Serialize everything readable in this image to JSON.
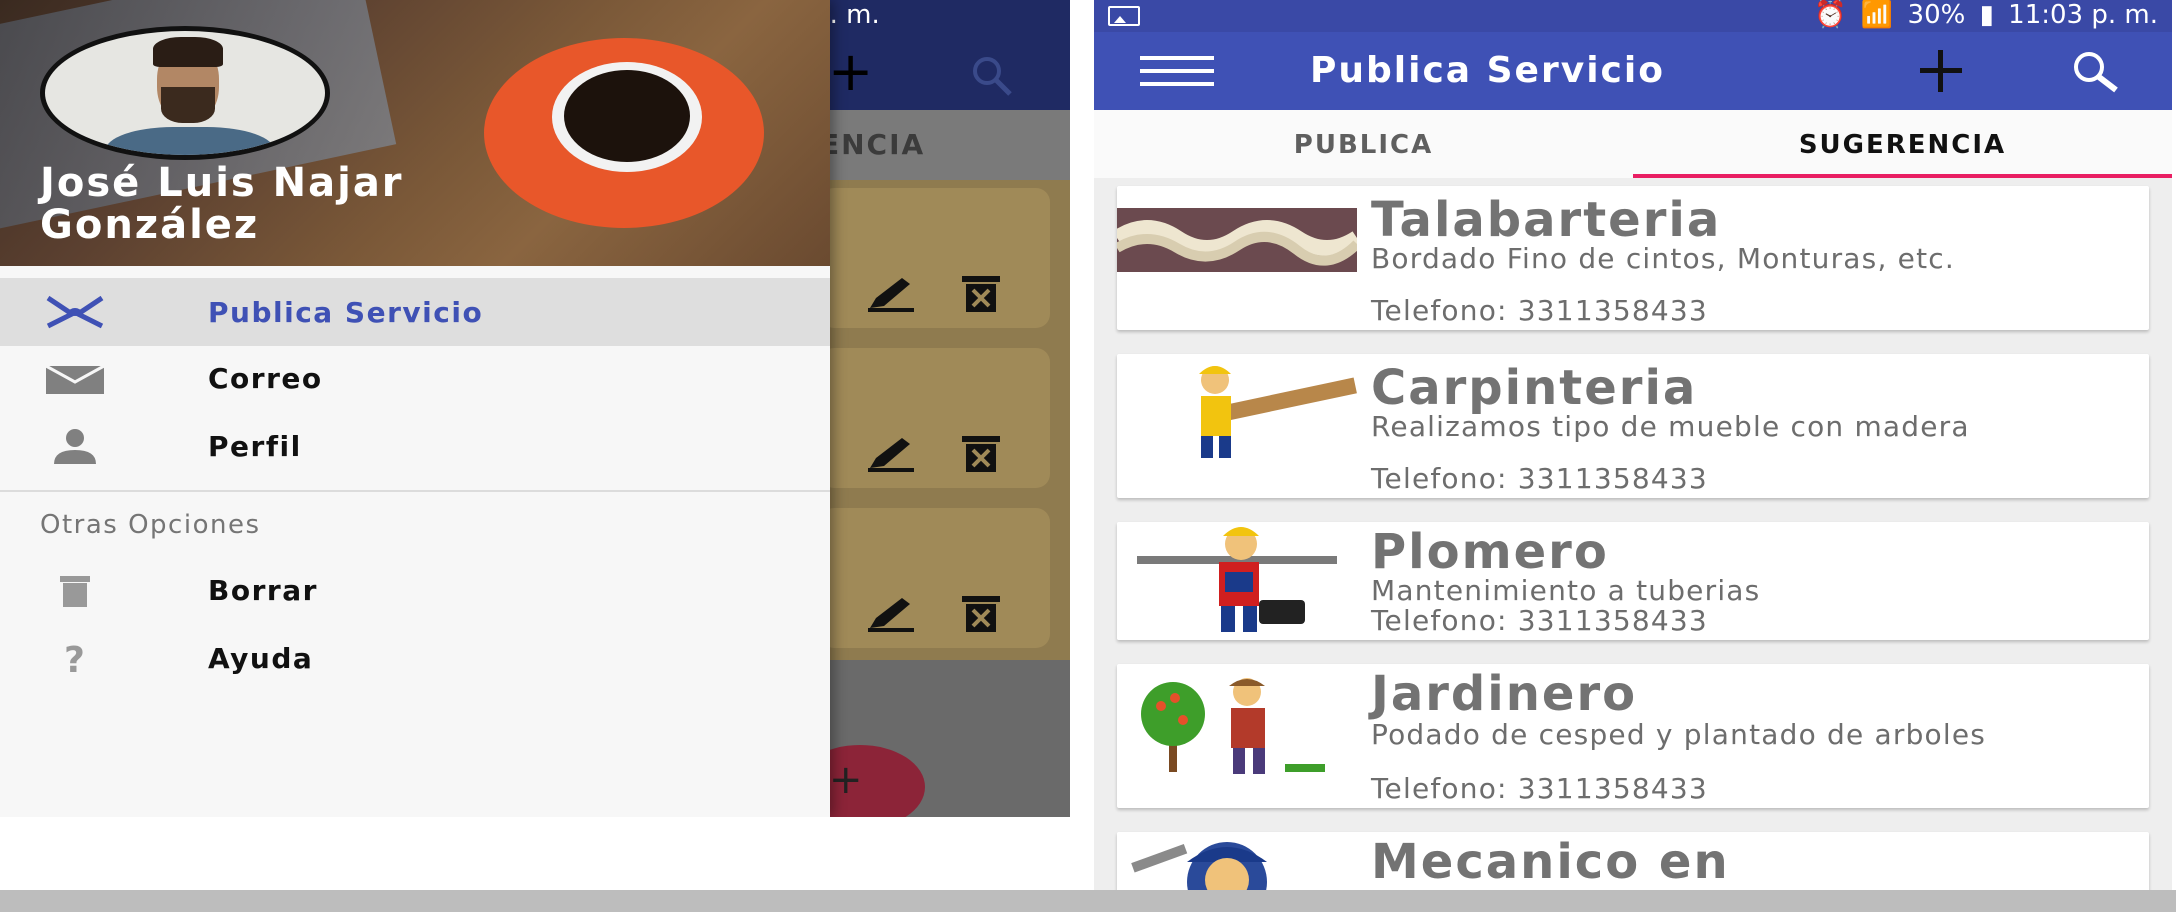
{
  "status_bar": {
    "battery": "30%",
    "time": "11:03 p. m."
  },
  "drawer": {
    "user_name_line1": "José Luis Najar",
    "user_name_line2": "González",
    "items": [
      {
        "label": "Publica Servicio",
        "icon": "fork-knife-icon",
        "active": true
      },
      {
        "label": "Correo",
        "icon": "mail-icon",
        "active": false
      },
      {
        "label": "Perfil",
        "icon": "person-icon",
        "active": false
      }
    ],
    "section_title": "Otras Opciones",
    "other_items": [
      {
        "label": "Borrar",
        "icon": "trash-icon"
      },
      {
        "label": "Ayuda",
        "icon": "help-icon"
      }
    ]
  },
  "background_app": {
    "tab_partial": "ENCIA"
  },
  "app": {
    "title": "Publica Servicio",
    "tabs": [
      {
        "label": "PUBLICA",
        "selected": false
      },
      {
        "label": "SUGERENCIA",
        "selected": true
      }
    ],
    "accent_color": "#3f51b5",
    "tab_indicator_color": "#e91e63"
  },
  "services": [
    {
      "title": "Talabarteria",
      "description": "Bordado Fino de cintos, Monturas, etc.",
      "phone": "Telefono: 3311358433",
      "image": "braided-rope-image"
    },
    {
      "title": "Carpinteria",
      "description": "Realizamos  tipo de mueble con madera",
      "phone": "Telefono: 3311358433",
      "image": "carpenter-image"
    },
    {
      "title": "Plomero",
      "description": "Mantenimiento a tuberias",
      "phone": "Telefono: 3311358433",
      "image": "plumber-image"
    },
    {
      "title": "Jardinero",
      "description": "Podado de cesped y plantado de arboles",
      "phone": "Telefono: 3311358433",
      "image": "gardener-image"
    },
    {
      "title": "Mecanico en",
      "description": "",
      "phone": "",
      "image": "mechanic-image"
    }
  ]
}
